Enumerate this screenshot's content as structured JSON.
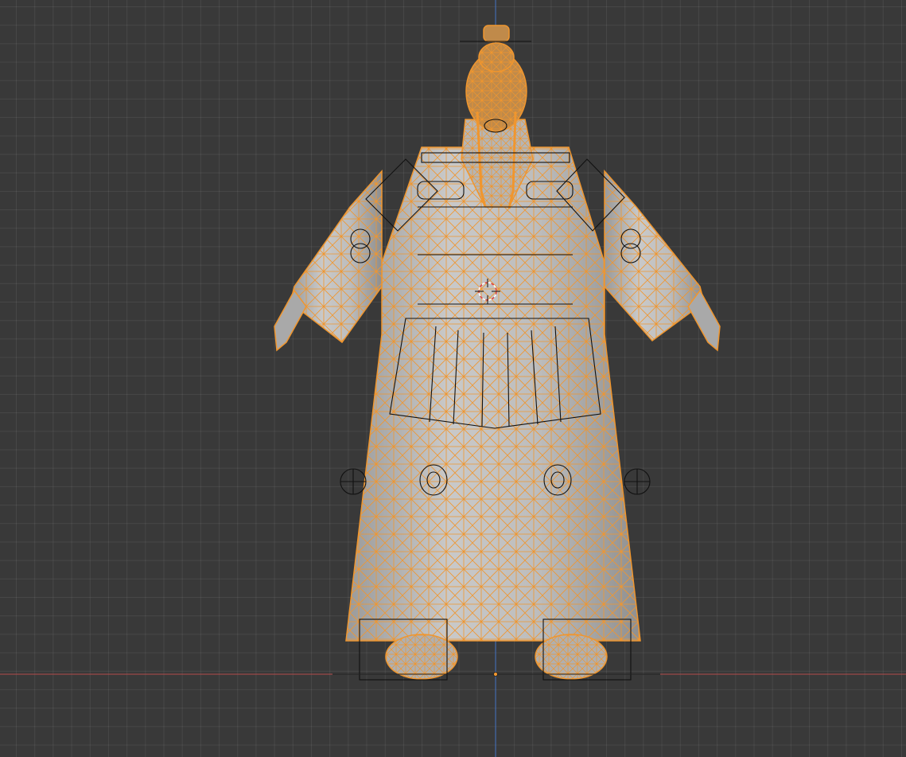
{
  "viewport": {
    "background_color": "#393939",
    "grid_color": "#4a4a4a",
    "x_axis_color": "#b44a4a",
    "z_axis_color": "#3f6fc0",
    "selection_color": "#f0962e",
    "mesh_fill_color": "#b8b8b8",
    "armature_widget_color": "#111111",
    "cursor_icon": "3d-cursor-icon",
    "origin_icon": "object-origin-icon"
  },
  "scene": {
    "object": "character-mesh-robe",
    "selected": true,
    "display": "solid-with-wireframe-overlay",
    "rig_controls": [
      "head-control",
      "shoulder-control-left",
      "shoulder-control-right",
      "chest-control",
      "hip-control",
      "knee-control-left",
      "knee-control-right",
      "skirt-control",
      "foot-control-left",
      "foot-control-right"
    ]
  }
}
